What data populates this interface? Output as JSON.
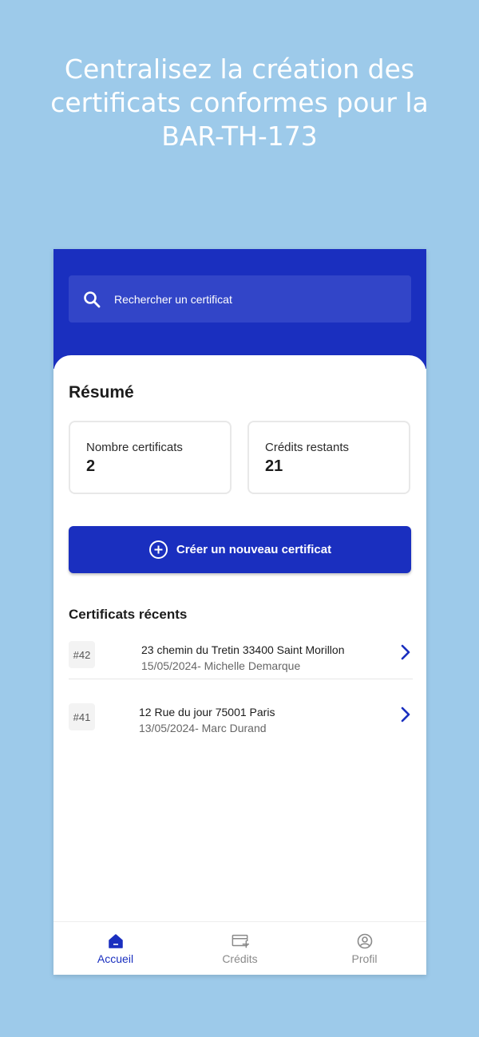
{
  "promo": {
    "headline": "Centralisez la création des certificats conformes pour la BAR-TH-173"
  },
  "colors": {
    "background": "#9dcaea",
    "primary": "#1a2fbf",
    "search_bg": "#3245c8"
  },
  "search": {
    "placeholder": "Rechercher un certificat",
    "icon": "search-icon"
  },
  "summary": {
    "title": "Résumé",
    "cards": [
      {
        "label": "Nombre certificats",
        "value": "2"
      },
      {
        "label": "Crédits restants",
        "value": "21"
      }
    ]
  },
  "create_button": {
    "label": "Créer un nouveau certificat",
    "icon": "plus-circle-icon"
  },
  "recent": {
    "title": "Certificats récents",
    "items": [
      {
        "id": "#42",
        "address": "23 chemin du Tretin 33400 Saint Morillon",
        "meta": "15/05/2024- Michelle Demarque"
      },
      {
        "id": "#41",
        "address": "12 Rue du jour 75001 Paris",
        "meta": "13/05/2024- Marc Durand"
      }
    ]
  },
  "nav": {
    "items": [
      {
        "label": "Accueil",
        "icon": "home-icon",
        "active": true
      },
      {
        "label": "Crédits",
        "icon": "credit-card-icon",
        "active": false
      },
      {
        "label": "Profil",
        "icon": "user-circle-icon",
        "active": false
      }
    ]
  }
}
